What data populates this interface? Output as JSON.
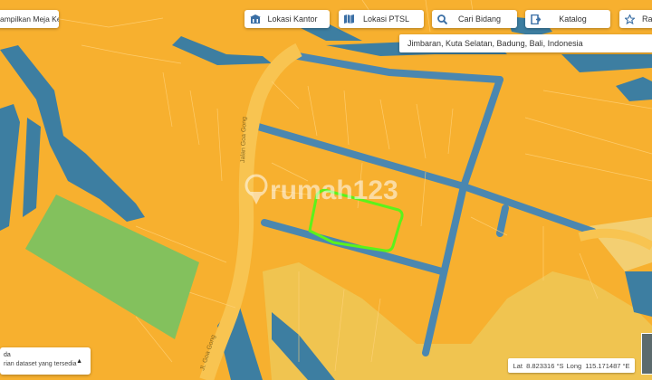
{
  "toolbar": {
    "meja_label": "ampilkan Meja Kerja",
    "kantor_label": "Lokasi Kantor",
    "ptsl_label": "Lokasi PTSL",
    "cari_label": "Cari Bidang",
    "katalog_label": "Katalog",
    "ra_label": "Ra"
  },
  "address": "Jimbaran, Kuta Selatan, Badung, Bali, Indonesia",
  "map": {
    "road_label_1": "Jalan Goa Gong",
    "road_label_2": "Jl. Goa Gong",
    "watermark": "rumah123",
    "colors": {
      "parcel": "#f7b02f",
      "road": "#3d7ea1",
      "roadway": "#f8c451",
      "green_area": "#83c15d",
      "selection": "#5cf21a",
      "sand": "#eec754"
    }
  },
  "layer_panel": {
    "line1": "da",
    "line2": "rian dataset yang tersedia"
  },
  "coords": {
    "lat_label": "Lat",
    "lat_value": "8.823316 °S",
    "long_label": "Long",
    "long_value": "115.171487 °E"
  }
}
